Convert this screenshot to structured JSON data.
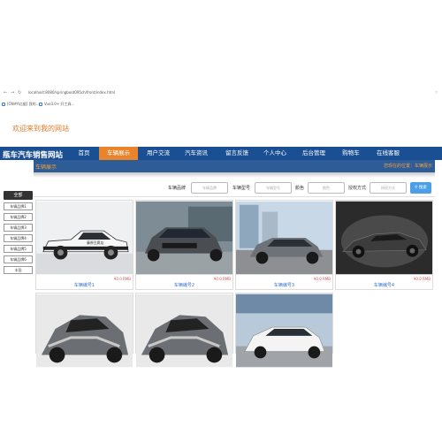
{
  "browser": {
    "url": "localhost:8080/springboot095ch/front/index.html",
    "bookmarks": [
      "[ON#A比据] 我的...",
      "Vue3.0+ 开工具..."
    ]
  },
  "welcome": "欢迎来到我的网站",
  "brand": "瓶车汽车销售网站",
  "nav": [
    "首页",
    "车辆展示",
    "用户交流",
    "汽车资讯",
    "留言反馈",
    "个人中心",
    "后台管理",
    "购物车",
    "在线客服"
  ],
  "nav_active": "车辆展示",
  "section": {
    "title": "车辆展示",
    "location": "您现在的位置：车辆展示"
  },
  "filters": {
    "brand_label": "车辆品牌",
    "brand_placeholder": "车辆品牌",
    "model_label": "车辆型号",
    "model_placeholder": "车辆型号",
    "color_label": "颜色",
    "color_placeholder": "颜色",
    "method_label": "授权方式",
    "method_placeholder": "授权方式",
    "search_label": "搜索"
  },
  "sidebar": {
    "header": "全部",
    "items": [
      "车辆品牌1",
      "车辆品牌2",
      "车辆品牌3",
      "车辆品牌4",
      "车辆品牌5",
      "车辆品牌6",
      "丰田"
    ]
  },
  "cards": [
    {
      "title": "车辆编号1",
      "price": "¥0.0 RMB"
    },
    {
      "title": "车辆编号2",
      "price": "¥0.0 RMB"
    },
    {
      "title": "车辆编号3",
      "price": "¥0.0 RMB"
    },
    {
      "title": "车辆编号4",
      "price": "¥0.0 RMB"
    },
    {
      "title": "",
      "price": ""
    },
    {
      "title": "",
      "price": ""
    },
    {
      "title": "",
      "price": ""
    }
  ],
  "colors": {
    "navbar": "#1b4f93",
    "active": "#e8852c",
    "subbar": "#2d5c97",
    "accent": "#f0a040",
    "button": "#4a9fe8"
  }
}
